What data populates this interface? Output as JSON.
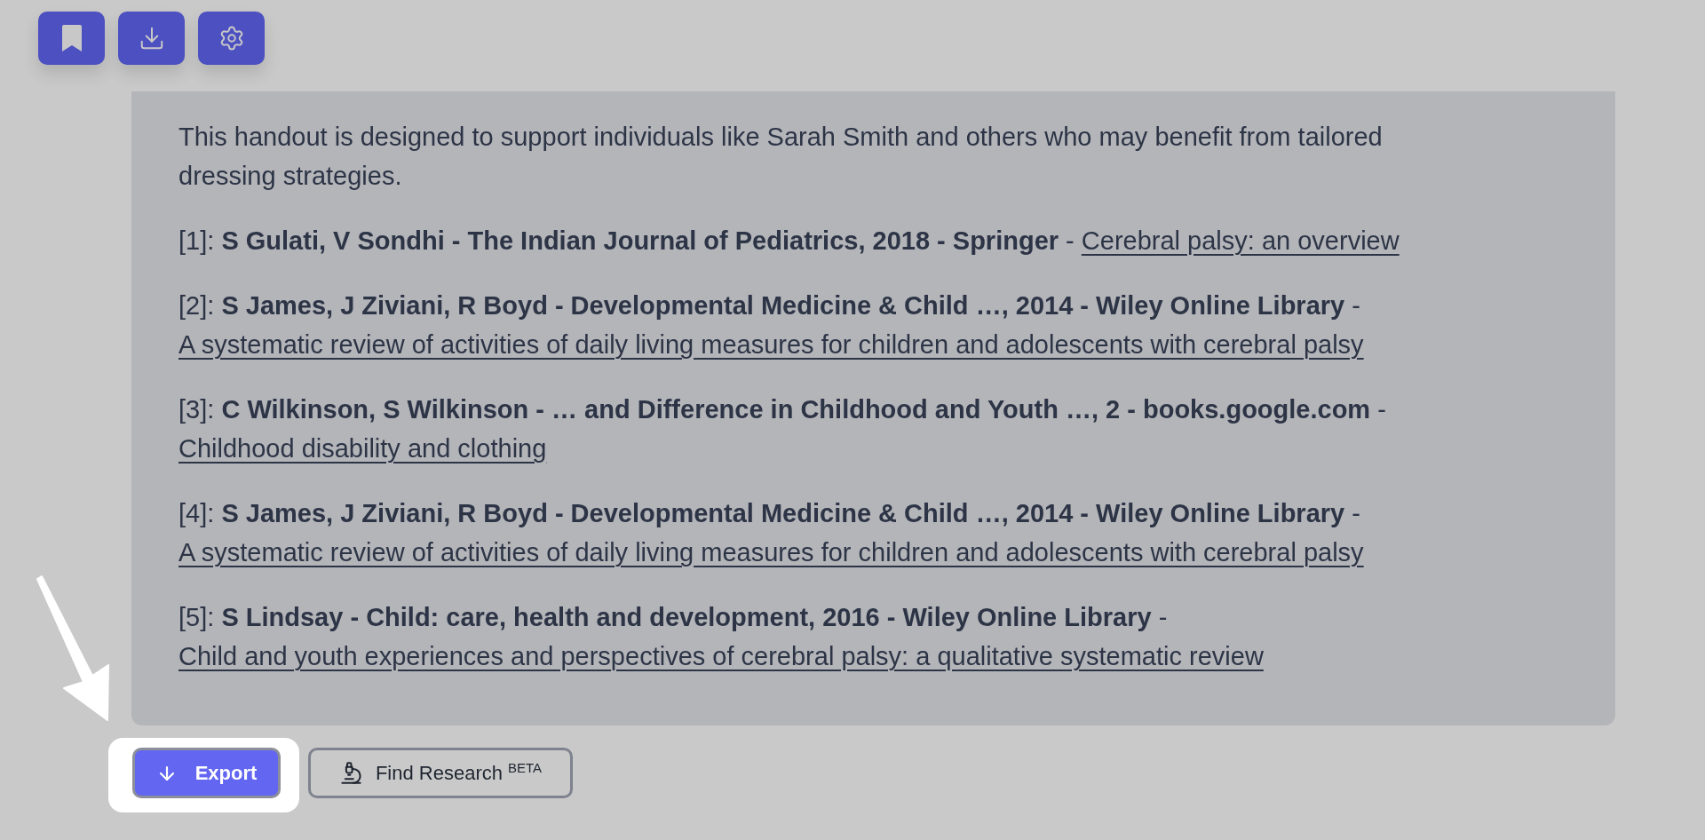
{
  "content": {
    "intro": "This handout is designed to support individuals like Sarah Smith and others who may benefit from tailored dressing strategies.",
    "references": [
      {
        "marker": "[1]:",
        "source": "S Gulati, V Sondhi - The Indian Journal of Pediatrics, 2018 - Springer",
        "separator": "-",
        "title": "Cerebral palsy: an overview"
      },
      {
        "marker": "[2]:",
        "source": "S James, J Ziviani, R Boyd - Developmental Medicine & Child …, 2014 - Wiley Online Library",
        "separator": "-",
        "title": "A systematic review of activities of daily living measures for children and adolescents with cerebral palsy"
      },
      {
        "marker": "[3]:",
        "source": "C Wilkinson, S Wilkinson - … and Difference in Childhood and Youth …, 2 - books.google.com",
        "separator": "-",
        "title": "Childhood disability and clothing"
      },
      {
        "marker": "[4]:",
        "source": "S James, J Ziviani, R Boyd - Developmental Medicine & Child …, 2014 - Wiley Online Library",
        "separator": "-",
        "title": "A systematic review of activities of daily living measures for children and adolescents with cerebral palsy"
      },
      {
        "marker": "[5]:",
        "source": "S Lindsay - Child: care, health and development, 2016 - Wiley Online Library",
        "separator": "-",
        "title": "Child and youth experiences and perspectives of cerebral palsy: a qualitative systematic review"
      }
    ]
  },
  "actions": [
    {
      "kind": "export",
      "label": "Export",
      "highlighted": true
    },
    {
      "kind": "research",
      "label": "Find Research",
      "badge": "BETA",
      "highlighted": false
    }
  ]
}
